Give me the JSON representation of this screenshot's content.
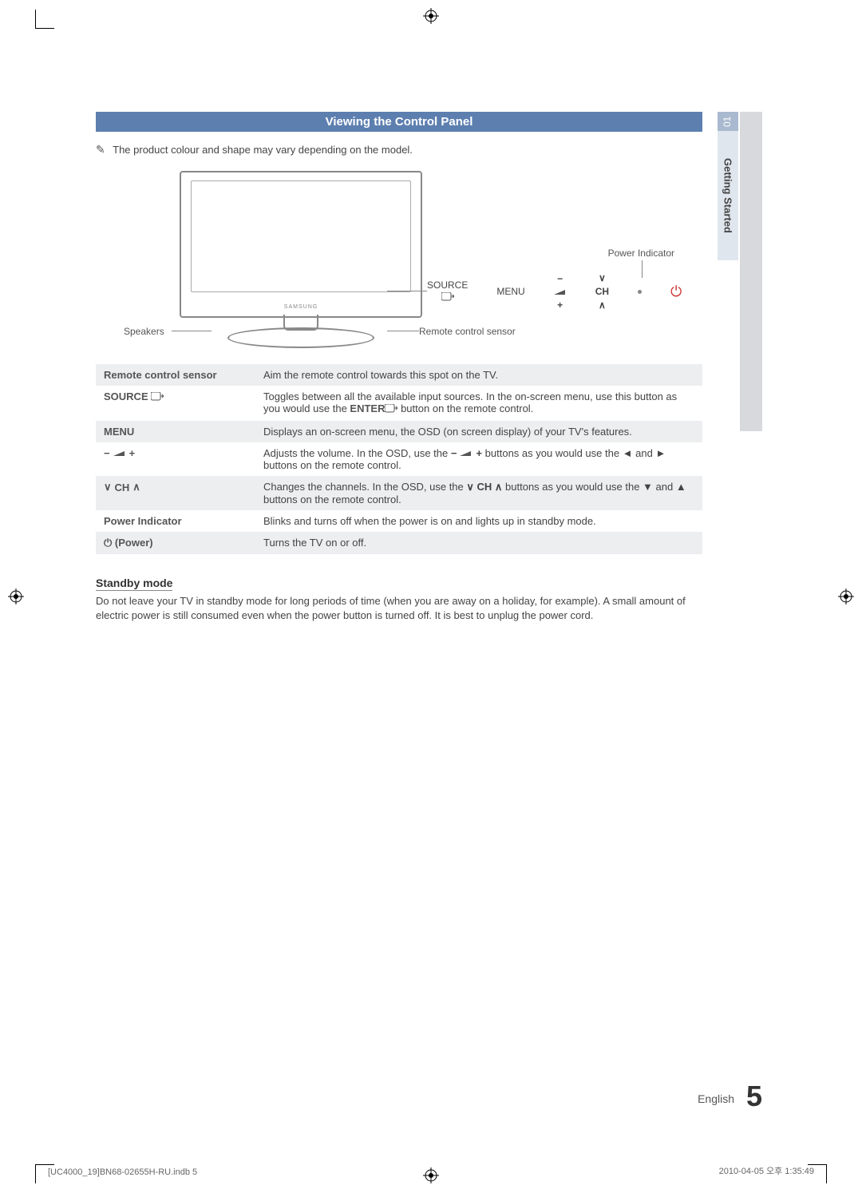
{
  "sidebar": {
    "chapter_num": "01",
    "chapter_title": "Getting Started"
  },
  "header": {
    "section_title": "Viewing the Control Panel",
    "note": "The product colour and shape may vary depending on the model."
  },
  "diagram": {
    "power_indicator_label": "Power Indicator",
    "speakers_label": "Speakers",
    "remote_sensor_label": "Remote control sensor",
    "tv_brand": "SAMSUNG",
    "panel_labels": {
      "source": "SOURCE",
      "menu": "MENU",
      "vol_minus": "−",
      "vol_plus": "+",
      "ch": "CH"
    }
  },
  "controls": [
    {
      "label": "Remote control sensor",
      "desc": "Aim the remote control towards this spot on the TV."
    },
    {
      "label": "SOURCE",
      "desc_pre": "Toggles between all the available input sources. In the on-screen menu, use this button as you would use the ",
      "desc_mid": "ENTER",
      "desc_post": " button on the remote control."
    },
    {
      "label": "MENU",
      "desc": "Displays an on-screen menu, the OSD (on screen display) of your TV's features."
    },
    {
      "label_icons": "vol",
      "desc_pre": "Adjusts the volume. In the OSD, use the ",
      "desc_post": " buttons as you would use the ◄ and ► buttons on the remote control."
    },
    {
      "label_icons": "ch",
      "desc_pre": "Changes the channels. In the OSD, use the ",
      "desc_post": " buttons as you would use the ▼ and ▲ buttons on the remote control."
    },
    {
      "label": "Power Indicator",
      "desc": "Blinks and turns off when the power is on and lights up in standby mode."
    },
    {
      "label_icons": "power",
      "label_suffix": " (Power)",
      "desc": "Turns the TV on or off."
    }
  ],
  "standby": {
    "heading": "Standby mode",
    "text": "Do not leave your TV in standby mode for long periods of time (when you are away on a holiday, for example). A small amount of electric power is still consumed even when the power button is turned off. It is best to unplug the power cord."
  },
  "footer": {
    "language": "English",
    "page_num": "5",
    "file_ref": "[UC4000_19]BN68-02655H-RU.indb   5",
    "timestamp": "2010-04-05   오후 1:35:49"
  }
}
